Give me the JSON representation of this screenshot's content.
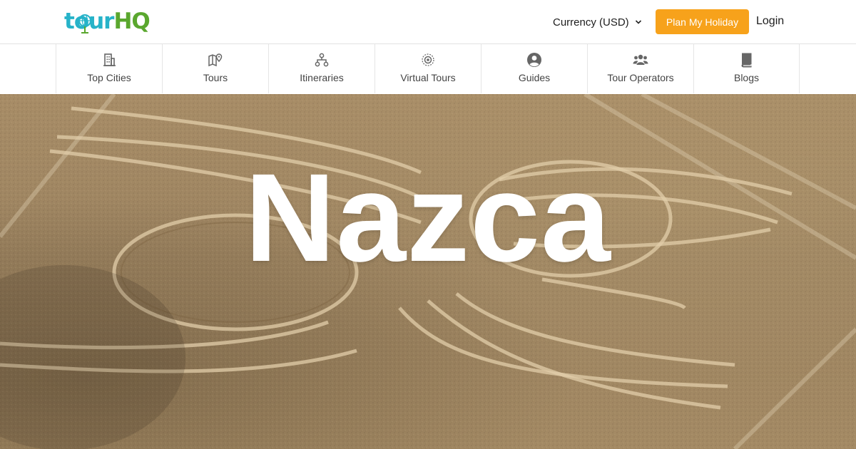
{
  "header": {
    "logo": {
      "part1": "tour",
      "part2": "HQ"
    },
    "currency_label": "Currency (USD)",
    "plan_button": "Plan My Holiday",
    "login_label": "Login"
  },
  "nav": {
    "items": [
      {
        "label": "Top Cities",
        "icon": "building-icon"
      },
      {
        "label": "Tours",
        "icon": "map-pin-icon"
      },
      {
        "label": "Itineraries",
        "icon": "sitemap-icon"
      },
      {
        "label": "Virtual Tours",
        "icon": "vr-icon"
      },
      {
        "label": "Guides",
        "icon": "user-circle-icon"
      },
      {
        "label": "Tour Operators",
        "icon": "users-icon"
      },
      {
        "label": "Blogs",
        "icon": "book-icon"
      }
    ]
  },
  "hero": {
    "title": "Nazca"
  },
  "colors": {
    "accent": "#f7a21b",
    "logo_blue": "#27b3c9",
    "logo_green": "#5aa72e"
  }
}
